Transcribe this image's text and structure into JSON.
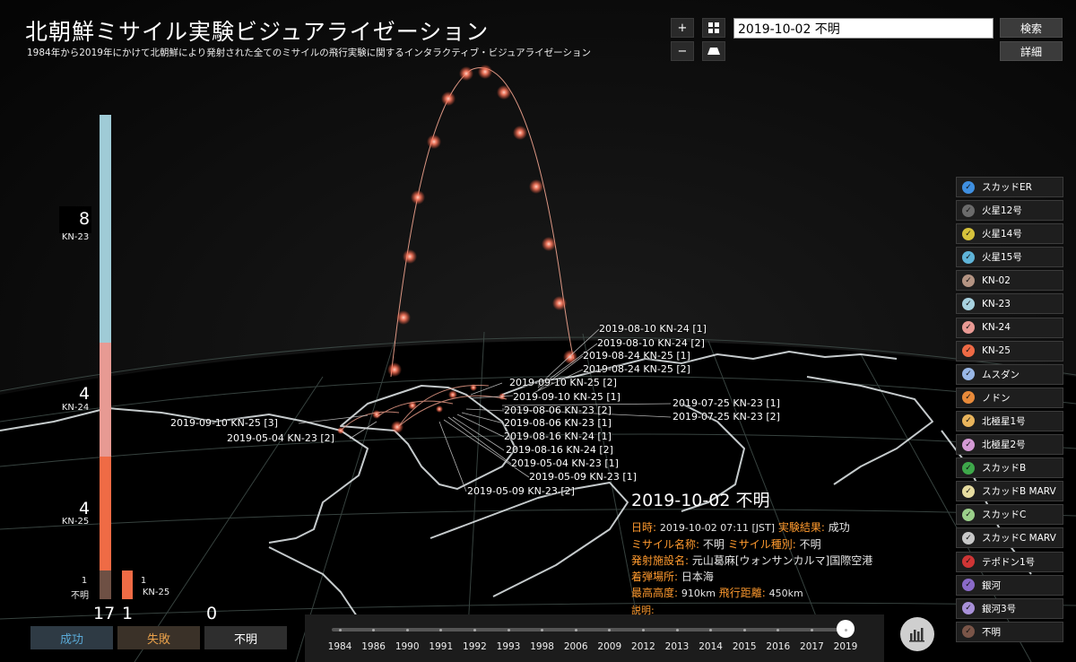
{
  "header": {
    "title": "北朝鮮ミサイル実験ビジュアライゼーション",
    "subtitle": "1984年から2019年にかけて北朝鮮により発射された全てのミサイルの飛行実験に関するインタラクティブ・ビジュアライゼーション"
  },
  "toolbar": {
    "zoom_in": "+",
    "zoom_out": "−",
    "search_value": "2019-10-02 不明",
    "search_button": "検索",
    "detail_button": "詳細"
  },
  "legend": [
    {
      "label": "スカッドER",
      "color": "#3f8fe0"
    },
    {
      "label": "火星12号",
      "color": "#6b6b6b"
    },
    {
      "label": "火星14号",
      "color": "#d6c23b"
    },
    {
      "label": "火星15号",
      "color": "#5fb4d8"
    },
    {
      "label": "KN-02",
      "color": "#b49483"
    },
    {
      "label": "KN-23",
      "color": "#a8d2e0"
    },
    {
      "label": "KN-24",
      "color": "#e99a94"
    },
    {
      "label": "KN-25",
      "color": "#ee6a45"
    },
    {
      "label": "ムスダン",
      "color": "#99b7e6"
    },
    {
      "label": "ノドン",
      "color": "#e88a3a"
    },
    {
      "label": "北極星1号",
      "color": "#e8b45c"
    },
    {
      "label": "北極星2号",
      "color": "#d49ad4"
    },
    {
      "label": "スカッドB",
      "color": "#3ea84a"
    },
    {
      "label": "スカッドB MARV",
      "color": "#e6dca0"
    },
    {
      "label": "スカッドC",
      "color": "#9bd08a"
    },
    {
      "label": "スカッドC MARV",
      "color": "#c8c8c8"
    },
    {
      "label": "テポドン1号",
      "color": "#cf3535"
    },
    {
      "label": "銀河",
      "color": "#8a6ac8"
    },
    {
      "label": "銀河3号",
      "color": "#a890d8"
    },
    {
      "label": "不明",
      "color": "#7a5548"
    }
  ],
  "stats": {
    "stack": [
      {
        "value": "8",
        "label": "KN-23",
        "color": "#9fcbd6"
      },
      {
        "value": "4",
        "label": "KN-24",
        "color": "#e79a93"
      },
      {
        "value": "4",
        "label": "KN-25",
        "color": "#ef6b45"
      }
    ],
    "small": [
      {
        "value": "1",
        "label": "不明",
        "color": "#6e5044"
      },
      {
        "value": "1",
        "label": "KN-25",
        "color": "#ef6b45"
      }
    ]
  },
  "filters": [
    {
      "label": "成功",
      "count": "17",
      "color": "#5aa9d6",
      "bg": "#2e3a44"
    },
    {
      "label": "失敗",
      "count": "1",
      "color": "#e8a04a",
      "bg": "#3a3128"
    },
    {
      "label": "不明",
      "count": "0",
      "color": "#ffffff",
      "bg": "#2e2e2e"
    }
  ],
  "timeline": {
    "years": [
      "1984",
      "1986",
      "1990",
      "1991",
      "1992",
      "1993",
      "1998",
      "2006",
      "2009",
      "2012",
      "2013",
      "2014",
      "2015",
      "2016",
      "2017",
      "2019"
    ],
    "selected": "2019"
  },
  "flight_labels": [
    "2019-08-10 KN-24 [1]",
    "2019-08-10 KN-24 [2]",
    "2019-08-24 KN-25 [1]",
    "2019-08-24 KN-25 [2]",
    "2019-09-10 KN-25 [2]",
    "2019-09-10 KN-25 [1]",
    "2019-07-25 KN-23 [1]",
    "2019-08-06 KN-23 [2]",
    "2019-07-25 KN-23 [2]",
    "2019-08-06 KN-23 [1]",
    "2019-09-10 KN-25 [3]",
    "2019-08-16 KN-24 [1]",
    "2019-05-04 KN-23 [2]",
    "2019-08-16 KN-24 [2]",
    "2019-05-04 KN-23 [1]",
    "2019-05-09 KN-23 [1]",
    "2019-05-09 KN-23 [2]"
  ],
  "detail": {
    "title": "2019-10-02 不明",
    "date_key": "日時:",
    "date_val": "2019-10-02 07:11 [JST]",
    "result_key": "実験結果:",
    "result_val": "成功",
    "name_key": "ミサイル名称:",
    "name_val": "不明",
    "type_key": "ミサイル種別:",
    "type_val": "不明",
    "facility_key": "発射施設名:",
    "facility_val": "元山葛麻[ウォンサンカルマ]国際空港",
    "landing_key": "着弾場所:",
    "landing_val": "日本海",
    "apogee_key": "最高高度:",
    "apogee_val": "910km",
    "distance_key": "飛行距離:",
    "distance_val": "450km",
    "desc_key": "説明:"
  }
}
